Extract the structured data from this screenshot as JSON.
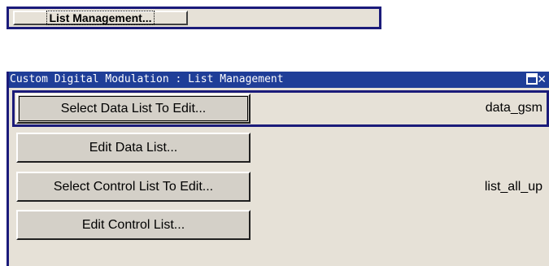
{
  "top_bar": {
    "list_management_label": "List Management..."
  },
  "dialog": {
    "title": "Custom Digital Modulation : List Management",
    "rows": [
      {
        "button_label": "Select Data List To Edit...",
        "value": "data_gsm"
      },
      {
        "button_label": "Edit Data List..."
      },
      {
        "button_label": "Select Control List To Edit...",
        "value": "list_all_up"
      },
      {
        "button_label": "Edit Control List..."
      }
    ]
  },
  "colors": {
    "titlebar": "#1f3e98",
    "frame_border": "#1b1b7a",
    "panel_background": "#e6e1d7"
  },
  "icons": [
    "maximize-icon",
    "close-icon"
  ]
}
